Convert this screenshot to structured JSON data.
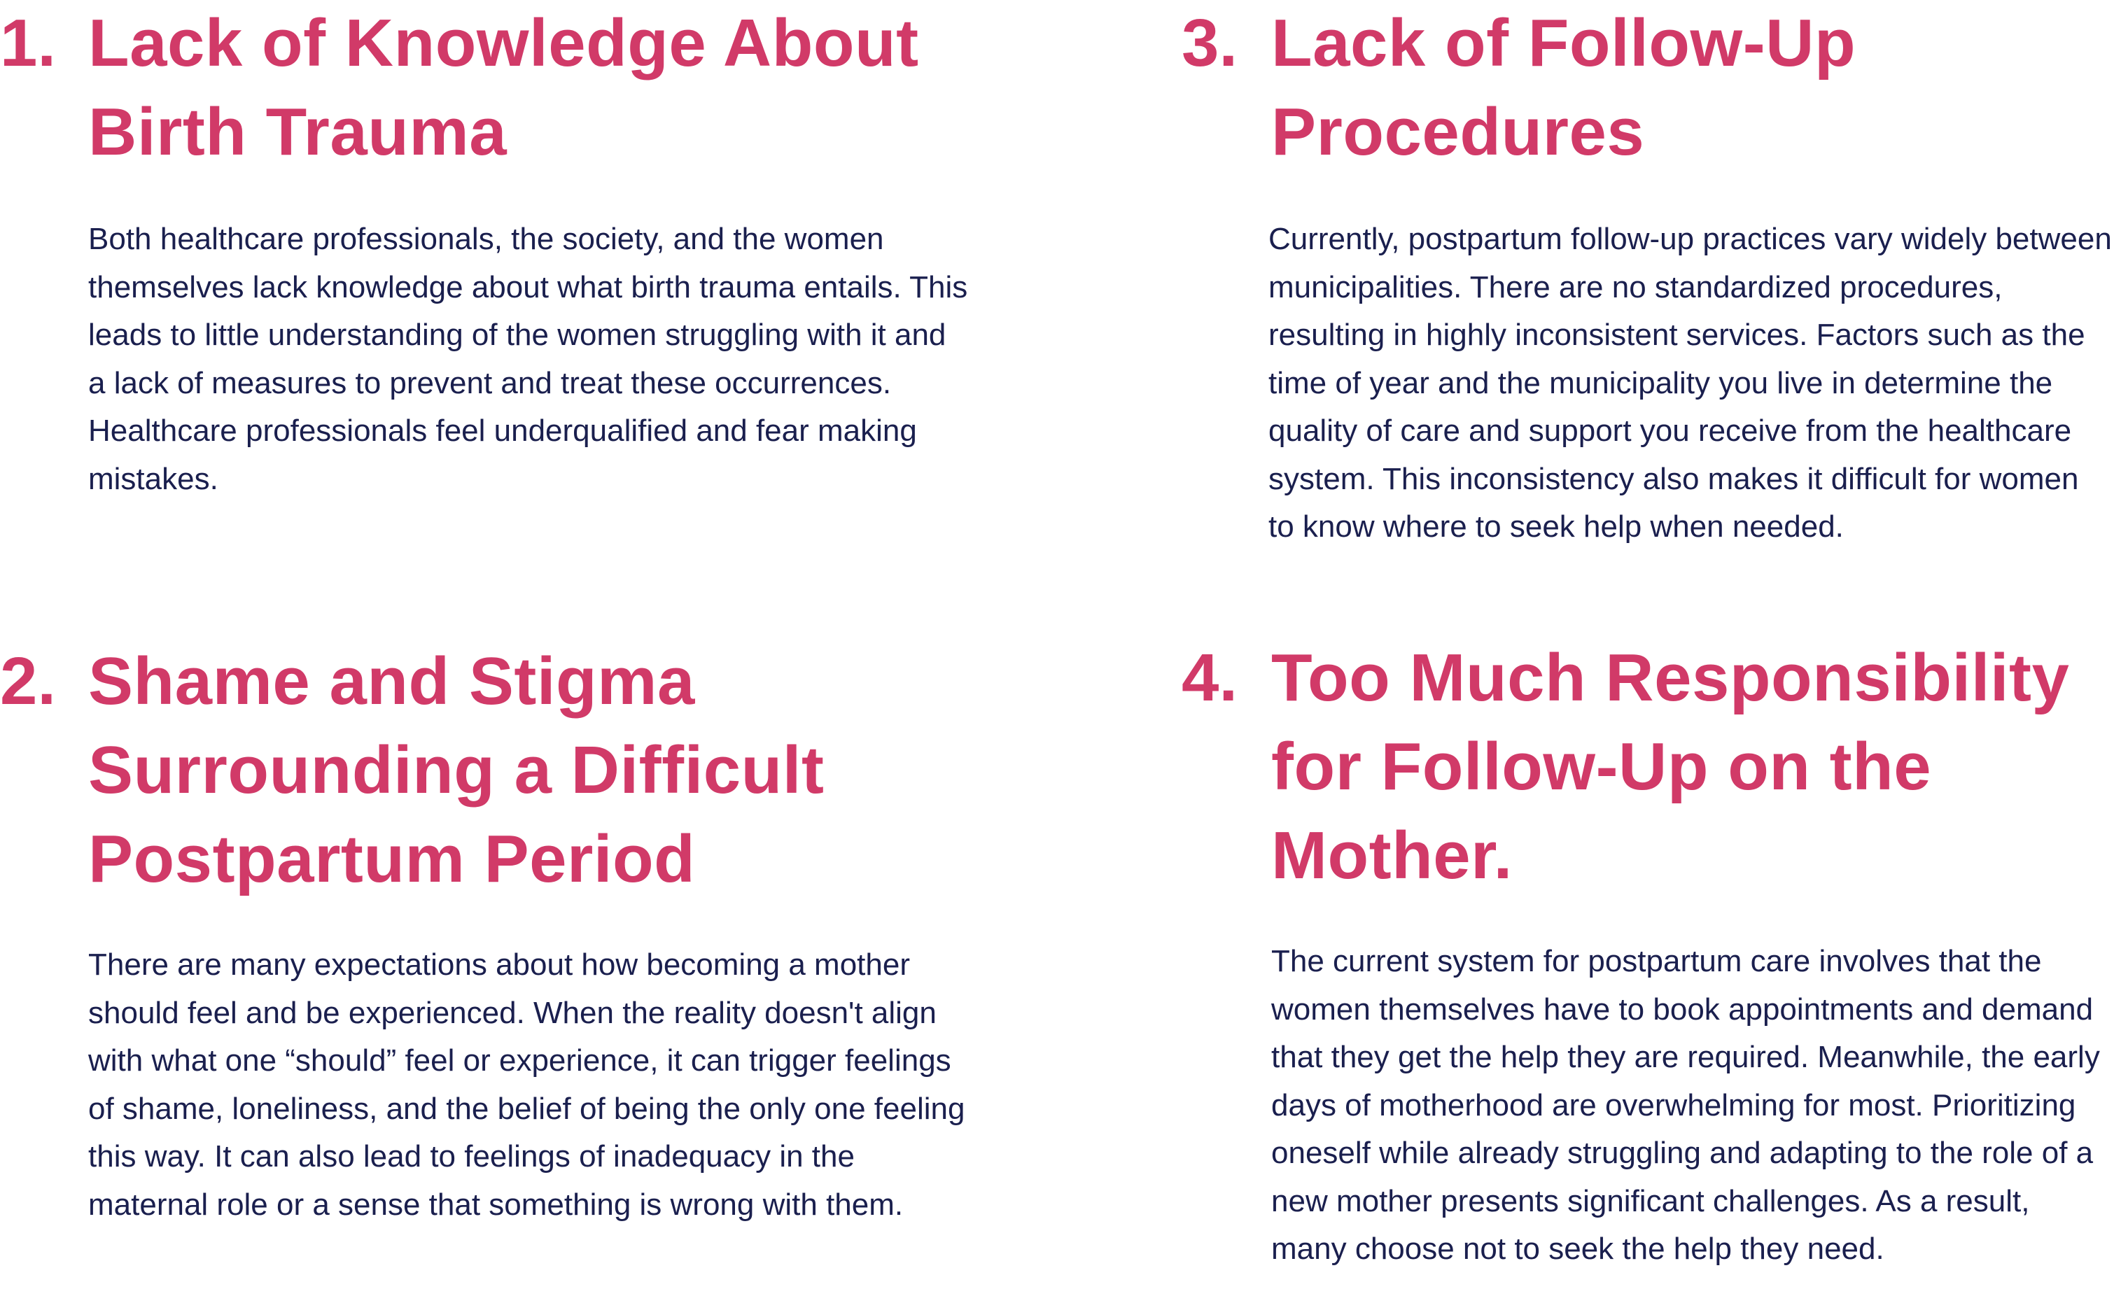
{
  "sections": [
    {
      "number": "1.",
      "title": "Lack of Knowledge About Birth Trauma",
      "body": "Both healthcare professionals, the society, and the women themselves lack knowledge about what birth trauma entails. This leads to little understanding of the women struggling with it and a lack of measures to prevent and treat these occurrences. Healthcare professionals feel underqualified and fear making mistakes."
    },
    {
      "number": "2.",
      "title": "Shame and Stigma Surrounding a Difficult Postpartum Period",
      "body": "There are many expectations about how becoming a mother should feel and be experienced. When the reality doesn't align with what one “should” feel or experience, it can trigger feelings of shame, loneliness, and the belief of being the only one feeling this way. It can also lead to feelings of inadequacy in the maternal role or a sense that something is wrong with them."
    },
    {
      "number": "3.",
      "title": "Lack of Follow-Up Procedures",
      "body": "Currently, postpartum follow-up practices vary widely between municipalities. There are no standardized procedures, resulting in highly inconsistent services. Factors such as the time of year and the municipality you live in determine the quality of care and support you receive from the healthcare system. This inconsistency also makes it difficult for women to know where to seek help when needed."
    },
    {
      "number": "4.",
      "title": "Too Much Responsibility for Follow-Up on the Mother.",
      "body": "The current system for postpartum care involves that the women themselves have to book appointments and demand that they get the help they are required. Meanwhile, the early days of motherhood are overwhelming for most. Prioritizing oneself while already struggling and adapting to the role of a new mother presents significant challenges. As a result, many choose not to seek the help they need."
    }
  ],
  "colors": {
    "heading": "#d13a68",
    "body": "#1a1f4e",
    "background": "#ffffff"
  }
}
